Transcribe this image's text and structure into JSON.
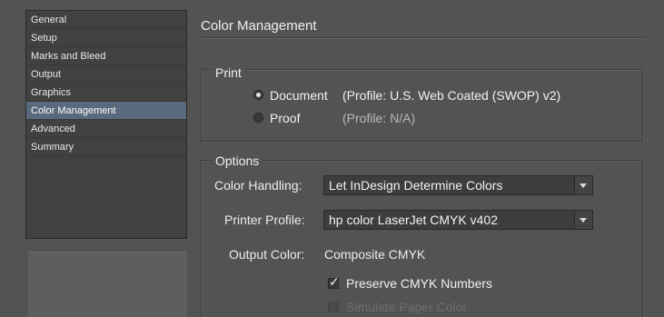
{
  "sidebar": {
    "items": [
      {
        "label": "General"
      },
      {
        "label": "Setup"
      },
      {
        "label": "Marks and Bleed"
      },
      {
        "label": "Output"
      },
      {
        "label": "Graphics"
      },
      {
        "label": "Color Management",
        "selected": true
      },
      {
        "label": "Advanced"
      },
      {
        "label": "Summary"
      }
    ]
  },
  "main": {
    "title": "Color Management",
    "print_group": {
      "legend": "Print",
      "document_label": "Document",
      "document_profile": "(Profile: U.S. Web Coated (SWOP) v2)",
      "document_selected": true,
      "proof_label": "Proof",
      "proof_profile": "(Profile: N/A)"
    },
    "options_group": {
      "legend": "Options",
      "color_handling_label": "Color Handling:",
      "color_handling_value": "Let InDesign Determine Colors",
      "printer_profile_label": "Printer Profile:",
      "printer_profile_value": "hp color LaserJet CMYK v402",
      "output_color_label": "Output Color:",
      "output_color_value": "Composite CMYK",
      "preserve_cmyk_label": "Preserve CMYK Numbers",
      "preserve_cmyk_checked": true,
      "simulate_paper_label": "Simulate Paper Color",
      "simulate_paper_checked": false,
      "simulate_paper_enabled": false
    }
  },
  "colors": {
    "background": "#535353",
    "selection": "#5a6a7e",
    "text": "#f0f0f0",
    "disabled_text": "#6e6e6e"
  }
}
